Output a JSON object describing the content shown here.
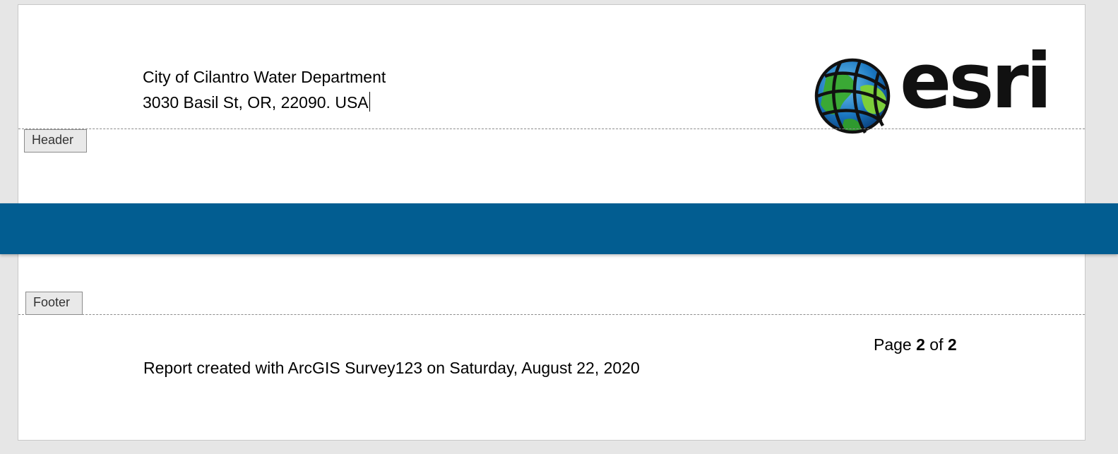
{
  "header": {
    "line1": "City of Cilantro Water Department",
    "line2": "3030 Basil St, OR, 22090. USA",
    "label": "Header",
    "logo": {
      "name": "esri-logo",
      "wordmark": "esri",
      "icon": "globe-icon"
    }
  },
  "footer": {
    "label": "Footer",
    "page_prefix": "Page",
    "page_current": "2",
    "page_of": "of",
    "page_total": "2",
    "report_text": "Report created with ArcGIS Survey123 on Saturday, August 22, 2020"
  },
  "colors": {
    "band": "#025d91",
    "background": "#e6e6e6",
    "page": "#ffffff"
  }
}
